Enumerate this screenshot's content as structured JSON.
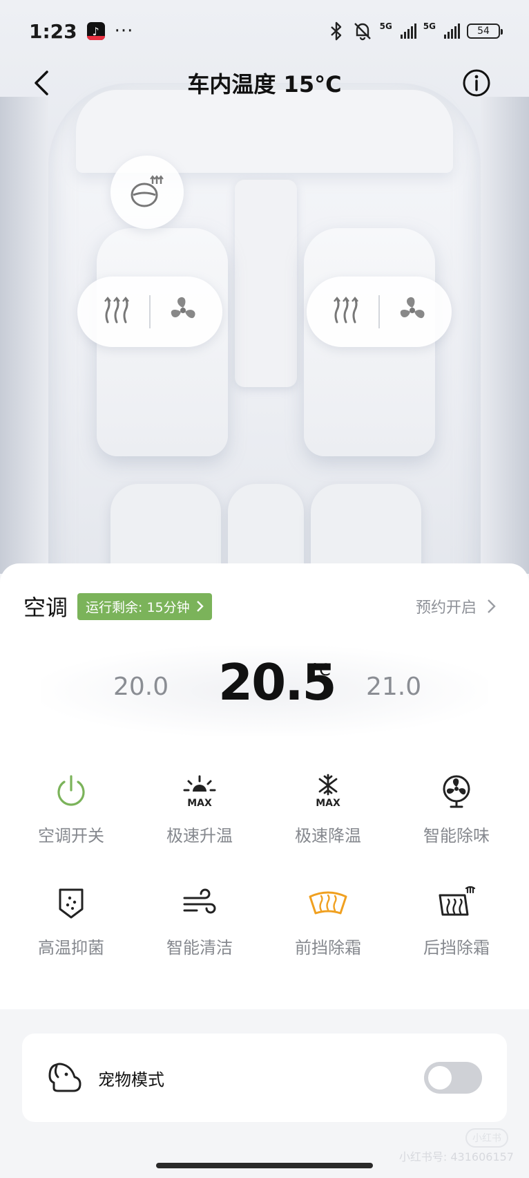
{
  "status_bar": {
    "time": "1:23",
    "more": "···",
    "sim1": "5G",
    "sim2": "5G",
    "battery": "54"
  },
  "header": {
    "title": "车内温度 15°C"
  },
  "ac": {
    "title": "空调",
    "runtime": "运行剩余: 15分钟",
    "schedule": "预约开启",
    "temp_prev": "20.0",
    "temp_current": "20.5",
    "temp_unit": "°C",
    "temp_next": "21.0"
  },
  "controls": [
    {
      "label": "空调开关",
      "icon": "power-icon",
      "color": "#7bb35a"
    },
    {
      "label": "极速升温",
      "icon": "sun-max-icon"
    },
    {
      "label": "极速降温",
      "icon": "snowflake-max-icon"
    },
    {
      "label": "智能除味",
      "icon": "fan-icon"
    },
    {
      "label": "高温抑菌",
      "icon": "shield-icon"
    },
    {
      "label": "智能清洁",
      "icon": "wind-icon"
    },
    {
      "label": "前挡除霜",
      "icon": "front-defrost-icon",
      "color": "#f0a020"
    },
    {
      "label": "后挡除霜",
      "icon": "rear-defrost-icon"
    }
  ],
  "pet_mode": {
    "label": "宠物模式",
    "enabled": false
  },
  "watermark": {
    "logo": "小红书",
    "text": "小红书号: 431606157"
  }
}
